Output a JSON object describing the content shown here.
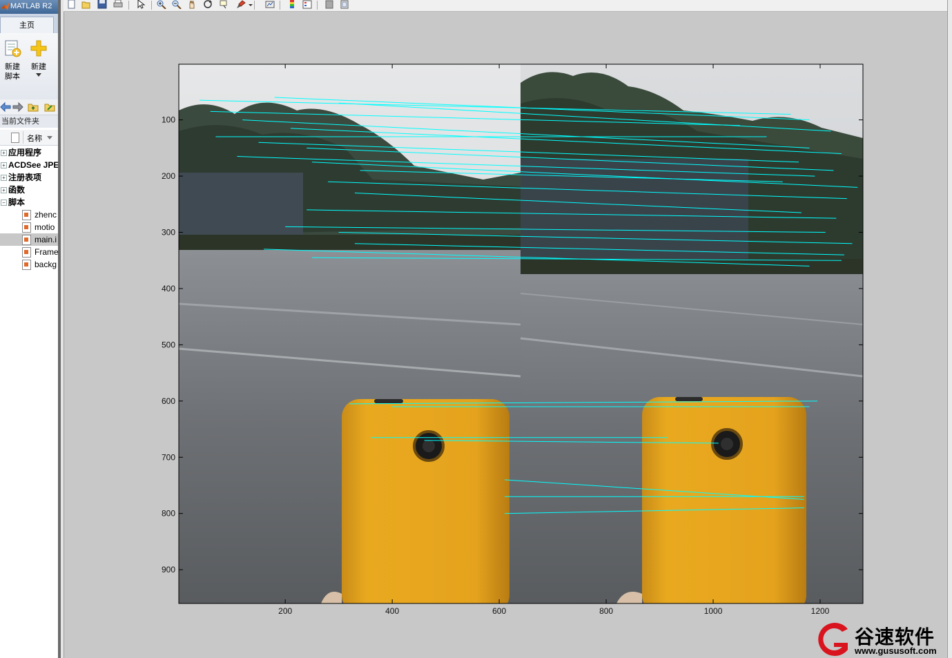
{
  "desktop": {
    "title": "MATLAB R2",
    "ribbon_tab": "主页",
    "new_script_label": "新建\n脚本",
    "new_label": "新建",
    "current_folder_label": "当前文件夹",
    "name_column": "名称",
    "tree": [
      {
        "label": "应用程序",
        "type": "folder",
        "expander": "+"
      },
      {
        "label": "ACDSee JPE",
        "type": "folder",
        "expander": "+"
      },
      {
        "label": "注册表项",
        "type": "folder",
        "expander": "+"
      },
      {
        "label": "函数",
        "type": "folder",
        "expander": "+"
      },
      {
        "label": "脚本",
        "type": "folder",
        "expander": "−"
      }
    ],
    "files": [
      {
        "label": "zhenc",
        "selected": false
      },
      {
        "label": "motio",
        "selected": false
      },
      {
        "label": "main.i",
        "selected": true
      },
      {
        "label": "Frame",
        "selected": false
      },
      {
        "label": "backg",
        "selected": false
      }
    ]
  },
  "figure": {
    "toolbar_icons": [
      "new-figure-icon",
      "open-icon",
      "save-icon",
      "print-icon",
      "pointer-icon",
      "zoom-in-icon",
      "zoom-out-icon",
      "pan-icon",
      "rotate-icon",
      "data-cursor-icon",
      "brush-icon",
      "link-icon",
      "colorbar-icon",
      "legend-icon",
      "hide-plot-tools-icon",
      "show-plot-tools-icon"
    ],
    "match_line_color": "#00ffff",
    "axes": {
      "xticks": [
        "200",
        "400",
        "600",
        "800",
        "1000",
        "1200"
      ],
      "yticks": [
        "100",
        "200",
        "300",
        "400",
        "500",
        "600",
        "700",
        "800",
        "900"
      ]
    }
  },
  "chart_data": {
    "type": "scatter",
    "x_unit": "image column (px)",
    "y_unit": "image row (px)",
    "xlim": [
      1,
      1280
    ],
    "ylim": [
      960,
      1
    ],
    "xticks": [
      200,
      400,
      600,
      800,
      1000,
      1200
    ],
    "yticks": [
      100,
      200,
      300,
      400,
      500,
      600,
      700,
      800,
      900
    ],
    "y_reversed": true,
    "grid": false,
    "background": "two side-by-side camera frames (trees, building, parking lot, yellow phone)",
    "match_color": "#00ffff",
    "matches": [
      [
        40,
        65,
        1145,
        90
      ],
      [
        180,
        60,
        1180,
        100
      ],
      [
        300,
        70,
        1220,
        120
      ],
      [
        60,
        85,
        1050,
        110
      ],
      [
        120,
        100,
        1180,
        150
      ],
      [
        210,
        115,
        1240,
        160
      ],
      [
        70,
        130,
        1100,
        130
      ],
      [
        150,
        140,
        1160,
        175
      ],
      [
        240,
        150,
        1225,
        190
      ],
      [
        110,
        165,
        1190,
        200
      ],
      [
        250,
        175,
        1270,
        220
      ],
      [
        340,
        190,
        1130,
        210
      ],
      [
        280,
        210,
        1250,
        240
      ],
      [
        330,
        230,
        1165,
        265
      ],
      [
        240,
        260,
        1230,
        275
      ],
      [
        200,
        290,
        1210,
        300
      ],
      [
        300,
        300,
        1260,
        320
      ],
      [
        330,
        320,
        1245,
        340
      ],
      [
        160,
        330,
        1180,
        360
      ],
      [
        250,
        345,
        1240,
        350
      ],
      [
        320,
        605,
        1195,
        600
      ],
      [
        400,
        610,
        1180,
        610
      ],
      [
        360,
        665,
        915,
        665
      ],
      [
        460,
        670,
        1010,
        675
      ],
      [
        610,
        740,
        1170,
        775
      ],
      [
        610,
        770,
        1170,
        770
      ],
      [
        610,
        800,
        1170,
        790
      ]
    ]
  }
}
